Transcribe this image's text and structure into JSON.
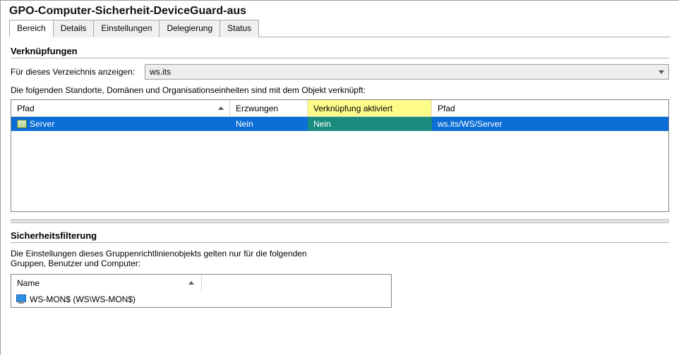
{
  "title": "GPO-Computer-Sicherheit-DeviceGuard-aus",
  "tabs": {
    "bereich": "Bereich",
    "details": "Details",
    "einstellungen": "Einstellungen",
    "delegierung": "Delegierung",
    "status": "Status"
  },
  "links_section": {
    "heading": "Verknüpfungen",
    "directory_label": "Für dieses Verzeichnis anzeigen:",
    "directory_value": "ws.its",
    "description": "Die folgenden Standorte, Domänen und Organisationseinheiten sind mit dem Objekt verknüpft:",
    "columns": {
      "pfad": "Pfad",
      "erzwungen": "Erzwungen",
      "verkn_aktiviert": "Verknüpfung aktiviert",
      "pfad2": "Pfad"
    },
    "row": {
      "name": "Server",
      "erzwungen": "Nein",
      "verkn_aktiviert": "Nein",
      "path": "ws.its/WS/Server"
    }
  },
  "filter_section": {
    "heading": "Sicherheitsfilterung",
    "description1": "Die Einstellungen dieses Gruppenrichtlinienobjekts gelten nur für die folgenden",
    "description2": "Gruppen, Benutzer und Computer:",
    "column": "Name",
    "row": "WS-MON$ (WS\\WS-MON$)"
  }
}
